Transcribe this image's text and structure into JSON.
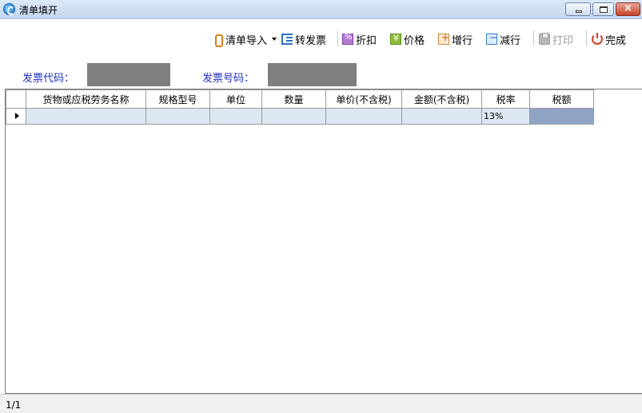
{
  "window": {
    "title": "清单填开",
    "controls": [
      "minimize",
      "maximize",
      "close"
    ],
    "close_label": "×"
  },
  "toolbar": {
    "import_label": "清单导入",
    "transfer_label": "转发票",
    "discount_label": "折扣",
    "price_label": "价格",
    "add_row_label": "增行",
    "delete_row_label": "减行",
    "print_label": "打印",
    "finish_label": "完成",
    "icons": [
      "import-icon",
      "transfer-invoice-icon",
      "discount-icon",
      "price-icon",
      "add-row-icon",
      "delete-row-icon",
      "printer-icon",
      "power-icon"
    ],
    "print_enabled": false
  },
  "invoice_info": {
    "code_label": "发票代码：",
    "number_label": "发票号码："
  },
  "grid": {
    "columns": [
      "货物或应税劳务名称",
      "规格型号",
      "单位",
      "数量",
      "单价(不含税)",
      "金额(不含税)",
      "税率",
      "税额"
    ],
    "rows": [
      {
        "cells": [
          "",
          "",
          "",
          "",
          "",
          "",
          "13%",
          ""
        ]
      }
    ]
  },
  "status": {
    "page": "1/1"
  },
  "colors": {
    "label_blue": "#1e30c0",
    "cell_fill": "#dde8f3",
    "tax_amount_fill": "#8fa4c4",
    "masked_value": "#7f7f7f"
  }
}
